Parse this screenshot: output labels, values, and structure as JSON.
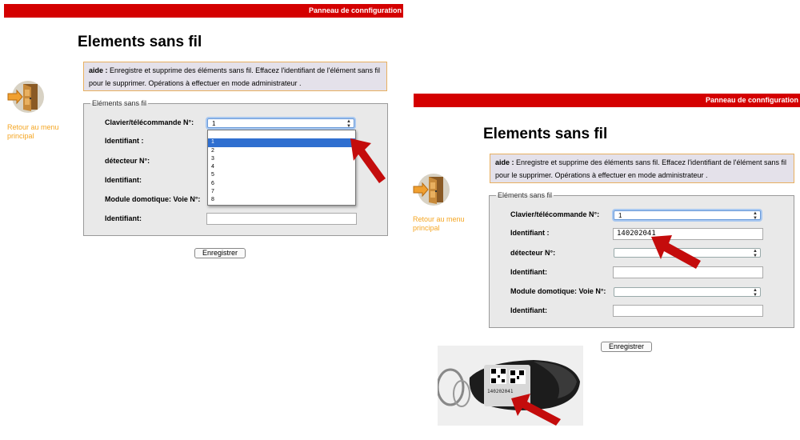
{
  "left": {
    "topbar_title": "Panneau de connfiguration",
    "page_title": "Elements sans fil",
    "help_label": "aide :",
    "help_text": "Enregistre et supprime des éléments sans fil. Effacez l'identifiant de l'élément sans fil pour le supprimer. Opérations à effectuer en mode administrateur .",
    "back_link": "Retour au menu principal",
    "fieldset_legend": "Eléments sans fil",
    "rows": {
      "keypad_label": "Clavier/télécommande N°:",
      "keypad_value": "1",
      "id1_label": "Identifiant :",
      "detector_label": "détecteur N°:",
      "id2_label": "Identifiant:",
      "module_label": "Module domotique: Voie N°:",
      "id3_label": "Identifiant:"
    },
    "dropdown_options": [
      "",
      "1",
      "2",
      "3",
      "4",
      "5",
      "6",
      "7",
      "8"
    ],
    "dropdown_selected": "1",
    "save_button": "Enregistrer"
  },
  "right": {
    "topbar_title": "Panneau de connfiguration",
    "page_title": "Elements sans fil",
    "help_label": "aide :",
    "help_text": "Enregistre et supprime des éléments sans fil. Effacez l'identifiant de l'élément sans fil pour le supprimer. Opérations à effectuer en mode administrateur .",
    "back_link": "Retour au menu principal",
    "fieldset_legend": "Eléments sans fil",
    "rows": {
      "keypad_label": "Clavier/télécommande N°:",
      "keypad_value": "1",
      "id1_label": "Identifiant :",
      "id1_value": "140202041",
      "detector_label": "détecteur N°:",
      "detector_value": "",
      "id2_label": "Identifiant:",
      "module_label": "Module domotique: Voie N°:",
      "module_value": "",
      "id3_label": "Identifiant:"
    },
    "save_button": "Enregistrer"
  },
  "photo": {
    "tag_text": "140202041"
  },
  "colors": {
    "topbar": "#d40000",
    "link": "#f5a623",
    "help_border": "#e8b060",
    "arrow": "#c40c0c",
    "selection": "#2f6fd0"
  }
}
